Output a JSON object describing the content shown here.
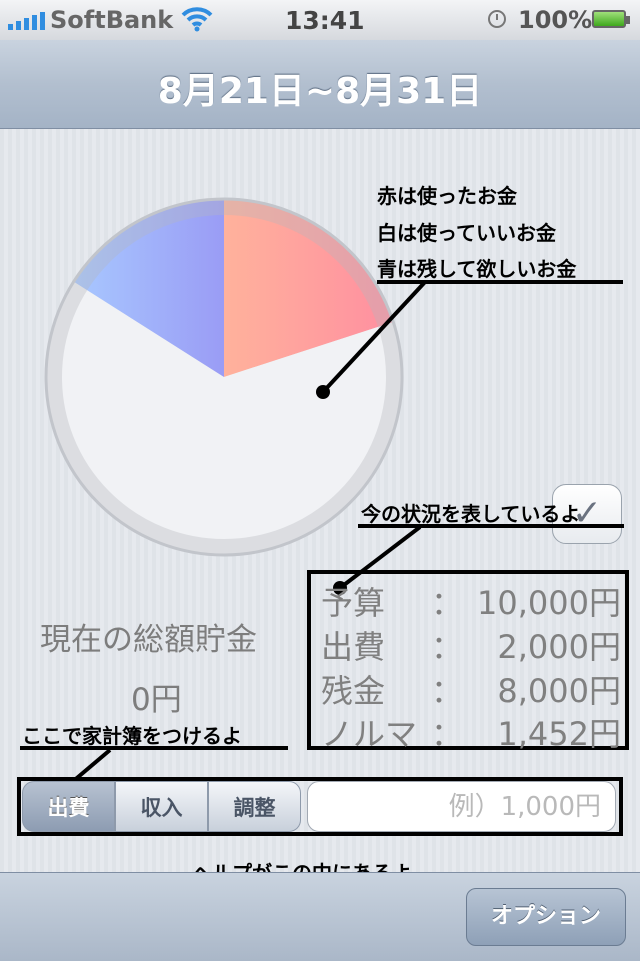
{
  "statusbar": {
    "carrier": "SoftBank",
    "time": "13:41",
    "battery": "100%"
  },
  "nav": {
    "title": "8月21日~8月31日"
  },
  "chart_data": {
    "type": "pie",
    "slices": [
      {
        "label": "赤は使ったお金",
        "value": 20,
        "color": "#ff9b9b"
      },
      {
        "label": "白は使っていいお金",
        "value": 64,
        "color": "#f1f2f5"
      },
      {
        "label": "青は残して欲しいお金",
        "value": 16,
        "color": "#9fb0ff"
      }
    ]
  },
  "annotations": {
    "legend_red": "赤は使ったお金",
    "legend_white": "白は使っていいお金",
    "legend_blue": "青は残して欲しいお金",
    "status_note": "今の状況を表しているよ",
    "input_note": "ここで家計簿をつけるよ",
    "help_note": "ヘルプがこの中にあるよ"
  },
  "savings": {
    "label": "現在の総額貯金",
    "value": "0円"
  },
  "status": {
    "rows": [
      {
        "label": "予算",
        "sep": "：",
        "value": "10,000円"
      },
      {
        "label": "出費",
        "sep": "：",
        "value": "2,000円"
      },
      {
        "label": "残金",
        "sep": "：",
        "value": "8,000円"
      },
      {
        "label": "ノルマ",
        "sep": "：",
        "value": "1,452円"
      }
    ],
    "check_symbol": "✓"
  },
  "entry": {
    "segments": [
      "出費",
      "収入",
      "調整"
    ],
    "selected": "出費",
    "placeholder": "例）1,000円"
  },
  "toolbar": {
    "option_label": "オプション"
  }
}
